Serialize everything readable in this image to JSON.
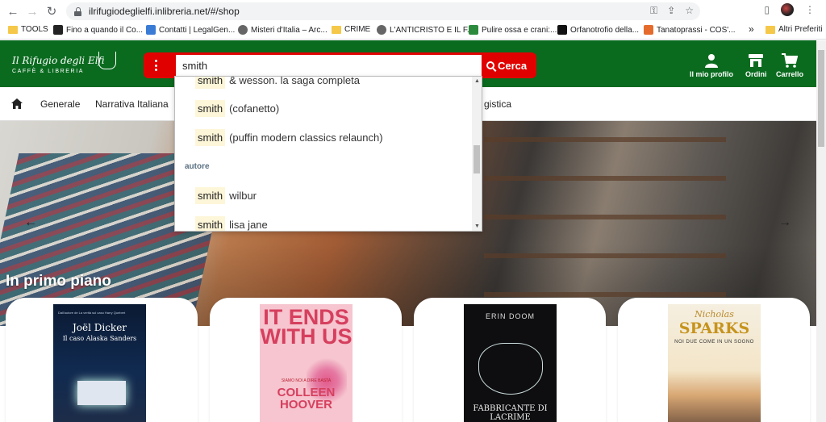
{
  "browser": {
    "url": "ilrifugiodeglielfi.inlibreria.net/#/shop",
    "bookmarks": [
      {
        "label": "TOOLS",
        "icon": "folder-icon"
      },
      {
        "label": "Fino a quando il Co...",
        "icon": "bookmark-page-icon"
      },
      {
        "label": "Contatti | LegalGen...",
        "icon": "bookmark-page-icon"
      },
      {
        "label": "Misteri d'Italia – Arc...",
        "icon": "globe-icon"
      },
      {
        "label": "CRIME",
        "icon": "folder-icon"
      },
      {
        "label": "L'ANTICRISTO E IL F...",
        "icon": "globe-icon"
      },
      {
        "label": "Pulire ossa e crani:...",
        "icon": "bookmark-page-icon"
      },
      {
        "label": "Orfanotrofio della...",
        "icon": "bookmark-page-icon"
      },
      {
        "label": "Tanatoprassi - COS'...",
        "icon": "bookmark-page-icon"
      }
    ],
    "more_bookmarks": "»",
    "other_bookmarks": "Altri Preferiti"
  },
  "header": {
    "logo_line1": "Il Rifugio degli Elfi",
    "logo_line2": "CAFFÈ & LIBRERIA",
    "search_value": "smith",
    "search_button": "Cerca",
    "actions": [
      {
        "label": "Il mio profilo",
        "icon": "user-icon"
      },
      {
        "label": "Ordini",
        "icon": "store-icon"
      },
      {
        "label": "Carrello",
        "icon": "cart-icon"
      }
    ]
  },
  "categories": [
    "Generale",
    "Narrativa Italiana",
    "gistica"
  ],
  "dropdown": {
    "items_top": [
      {
        "match": "smith",
        "rest": "& wesson. la saga completa"
      },
      {
        "match": "smith",
        "rest": "(cofanetto)"
      },
      {
        "match": "smith",
        "rest": "(puffin modern classics relaunch)"
      }
    ],
    "section_label": "autore",
    "items_author": [
      {
        "match": "smith",
        "rest": "wilbur"
      },
      {
        "match": "smith",
        "rest": "lisa jane"
      }
    ]
  },
  "hero": {
    "section_title": "In primo piano",
    "prev_arrow": "←",
    "next_arrow": "→"
  },
  "books": [
    {
      "tagline": "Dall'autore de La verità sul caso Harry Quebert",
      "author": "Joël Dicker",
      "title": "Il caso Alaska Sanders"
    },
    {
      "title": "IT ENDS WITH US",
      "subtitle": "SIAMO NOI A DIRE BASTA",
      "author": "COLLEEN HOOVER"
    },
    {
      "author": "ERIN DOOM",
      "title": "FABBRICANTE DI LACRIME"
    },
    {
      "author_first": "Nicholas",
      "author_last": "SPARKS",
      "title": "NOI DUE COME IN UN SOGNO"
    }
  ],
  "colors": {
    "brand_green": "#0a6b1f",
    "search_red": "#e00000"
  }
}
